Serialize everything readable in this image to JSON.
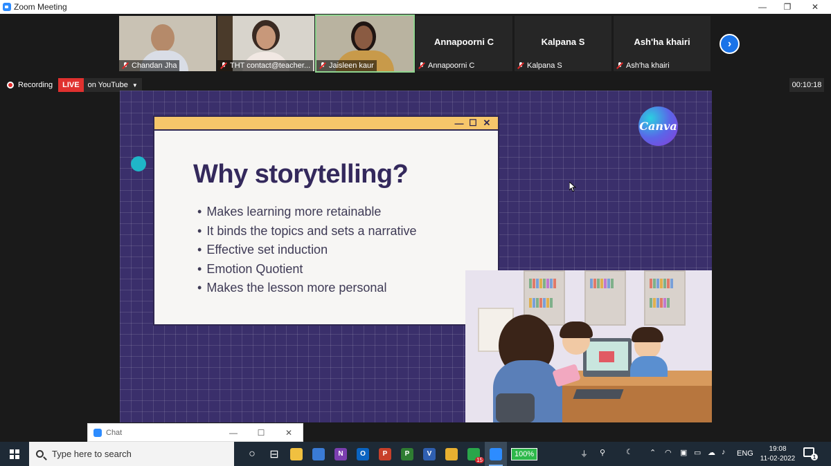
{
  "window": {
    "title": "Zoom Meeting",
    "controls": [
      "—",
      "❐",
      "✕"
    ]
  },
  "gallery": [
    {
      "name": "Chandan Jha",
      "muted": true,
      "video": true,
      "bg": "#c9c2b4",
      "face": "#b58a6a",
      "shirt": "#d9dde6"
    },
    {
      "name": "THT contact@teacher...",
      "muted": true,
      "video": true,
      "bg": "#d8d4cc",
      "face": "#c8987a",
      "shirt": "#f1e8e3"
    },
    {
      "name": "Jaisleen kaur",
      "muted": true,
      "video": true,
      "active": true,
      "bg": "#b9b3a0",
      "face": "#8a5b42",
      "shirt": "#c89a4a"
    },
    {
      "name": "Annapoorni C",
      "muted": true,
      "video": false
    },
    {
      "name": "Kalpana S",
      "muted": true,
      "video": false
    },
    {
      "name": "Ash'ha khairi",
      "muted": true,
      "video": false
    }
  ],
  "recording": {
    "label": "Recording",
    "live": "LIVE",
    "stream": "on YouTube"
  },
  "timer": "00:10:18",
  "slide": {
    "title": "Why storytelling?",
    "bullets": [
      "Makes learning more retainable",
      "It binds the topics and sets a narrative",
      "Effective set induction",
      "Emotion Quotient",
      "Makes the lesson more personal"
    ],
    "logo": "Canva",
    "colors": {
      "background": "#3a2f6b",
      "accent": "#f6c66a",
      "teal": "#1fb6c8"
    }
  },
  "chat": {
    "label": "Chat"
  },
  "taskbar": {
    "search_placeholder": "Type here to search",
    "apps": [
      {
        "name": "task-view",
        "glyph": "○",
        "color": "transparent"
      },
      {
        "name": "widgets",
        "glyph": "⊟",
        "color": "transparent"
      },
      {
        "name": "file-explorer",
        "glyph": "",
        "color": "#f0c040"
      },
      {
        "name": "microsoft-store",
        "glyph": "",
        "color": "#3a7bd5"
      },
      {
        "name": "onenote",
        "glyph": "N",
        "color": "#7b3fb0"
      },
      {
        "name": "outlook",
        "glyph": "O",
        "color": "#0a64c2"
      },
      {
        "name": "powerpoint",
        "glyph": "P",
        "color": "#c8402a"
      },
      {
        "name": "project",
        "glyph": "P",
        "color": "#2f7d32"
      },
      {
        "name": "visio",
        "glyph": "V",
        "color": "#2f5fb0"
      },
      {
        "name": "chrome",
        "glyph": "",
        "color": "#e8b030"
      },
      {
        "name": "whatsapp",
        "glyph": "",
        "color": "#2aa64a",
        "badge": "15"
      },
      {
        "name": "zoom",
        "glyph": "",
        "color": "#2d8cff",
        "active": true
      }
    ],
    "battery": "100%",
    "language": "ENG",
    "time": "19:08",
    "date": "11-02-2022",
    "notifications": "1"
  }
}
